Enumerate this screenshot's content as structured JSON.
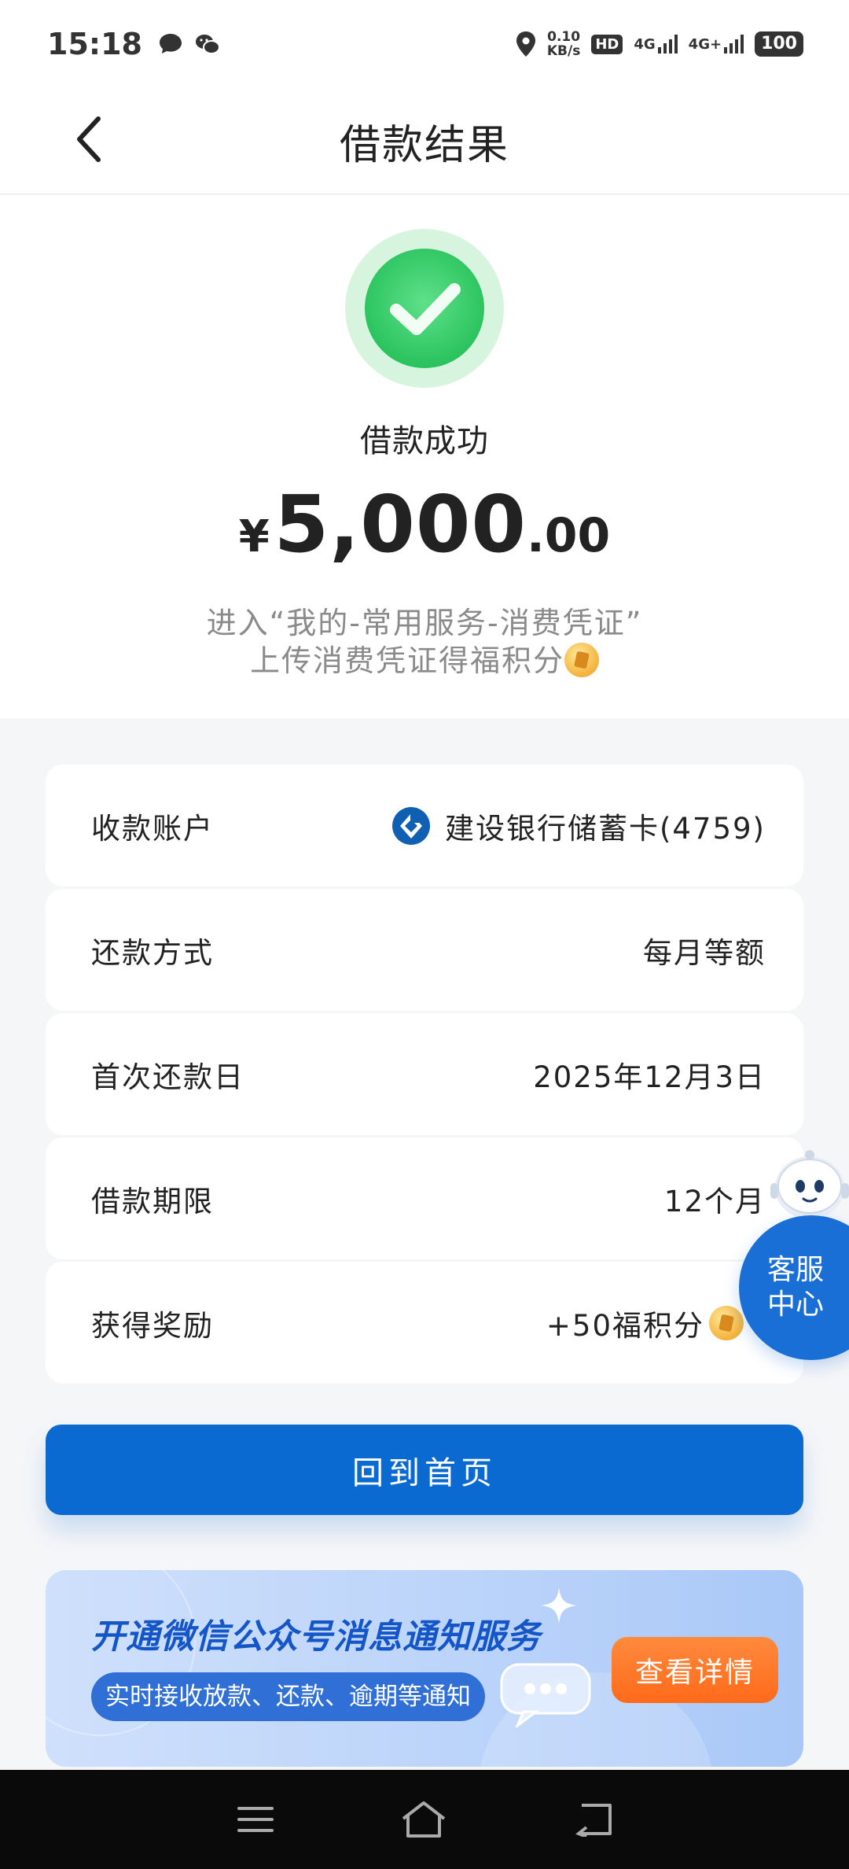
{
  "status_bar": {
    "time": "15:18",
    "net_speed_value": "0.10",
    "net_speed_unit": "KB/s",
    "hd_label": "HD",
    "sim1_label": "4G",
    "sim2_label": "4G+",
    "battery": "100"
  },
  "nav": {
    "title": "借款结果"
  },
  "result": {
    "status": "借款成功",
    "currency": "¥",
    "amount_int": "5,000",
    "amount_dec": ".00",
    "hint_line1": "进入“我的-常用服务-消费凭证”",
    "hint_line2": "上传消费凭证得福积分"
  },
  "details": [
    {
      "label": "收款账户",
      "value": "建设银行储蓄卡(4759)"
    },
    {
      "label": "还款方式",
      "value": "每月等额"
    },
    {
      "label": "首次还款日",
      "value": "2025年12月3日"
    },
    {
      "label": "借款期限",
      "value": "12个月"
    },
    {
      "label": "获得奖励",
      "value": "+50福积分"
    }
  ],
  "service_float": {
    "line1": "客服",
    "line2": "中心"
  },
  "home_button": "回到首页",
  "banner": {
    "title": "开通微信公众号消息通知服务",
    "subtitle": "实时接收放款、还款、逾期等通知",
    "button": "查看详情"
  },
  "colors": {
    "primary": "#0b6ad1",
    "success": "#34c759",
    "orange": "#ff7a2a"
  }
}
